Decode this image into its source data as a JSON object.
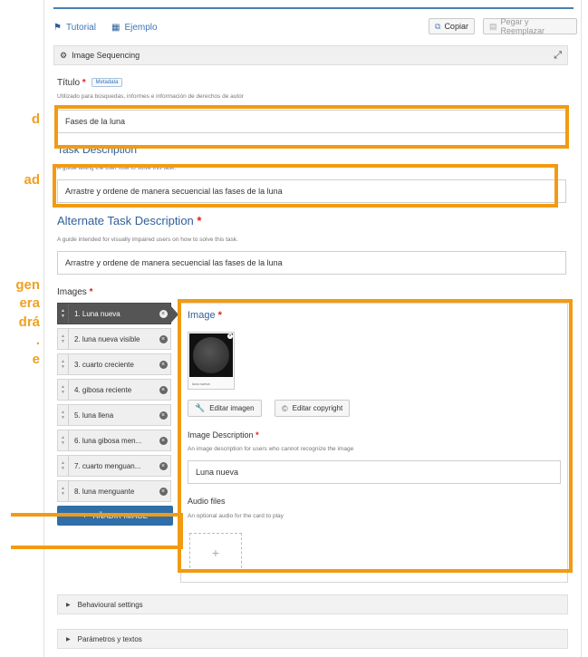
{
  "left_overlay": [
    "d",
    "ad",
    "gen",
    "era",
    "drá",
    ".",
    "e"
  ],
  "toolbar": {
    "tutorial": "Tutorial",
    "example": "Ejemplo",
    "copy": "Copiar",
    "paste_replace": "Pegar y Reemplazar"
  },
  "widget": {
    "title": "Image Sequencing"
  },
  "title_field": {
    "label": "Título",
    "badge": "Metadata",
    "hint": "Utilizado para búsquedas, informes e información de derechos de autor",
    "value": "Fases de la luna"
  },
  "task_description": {
    "label": "Task Description",
    "hint": "A guide telling the user how to solve this task.",
    "value": "Arrastre y ordene de manera secuencial las fases de la luna"
  },
  "alt_task_description": {
    "label": "Alternate Task Description",
    "hint": "A guide intended for visually impaired users on how to solve this task.",
    "value": "Arrastre y ordene de manera secuencial las fases de la luna"
  },
  "images": {
    "label": "Images",
    "items": [
      "1. Luna nueva",
      "2. luna nueva visible",
      "3. cuarto creciente",
      "4. gibosa reciente",
      "5. luna llena",
      "6. luna gibosa men...",
      "7. cuarto menguan...",
      "8. luna menguante"
    ],
    "add_button": "AÑADIR IMAGE"
  },
  "image_panel": {
    "image_label": "Image",
    "thumb_caption": "luna nueva",
    "edit_image": "Editar imagen",
    "edit_copyright": "Editar copyright",
    "desc_label": "Image Description",
    "desc_hint": "An image description for users who cannot recognize the image",
    "desc_value": "Luna nueva",
    "audio_label": "Audio files",
    "audio_hint": "An optional audio for the card to play"
  },
  "collapsibles": {
    "behavioural": "Behavioural settings",
    "params": "Parámetros y textos"
  },
  "colors": {
    "highlight": "#f29b12",
    "primary": "#2f6ea8",
    "required": "#e02020"
  }
}
